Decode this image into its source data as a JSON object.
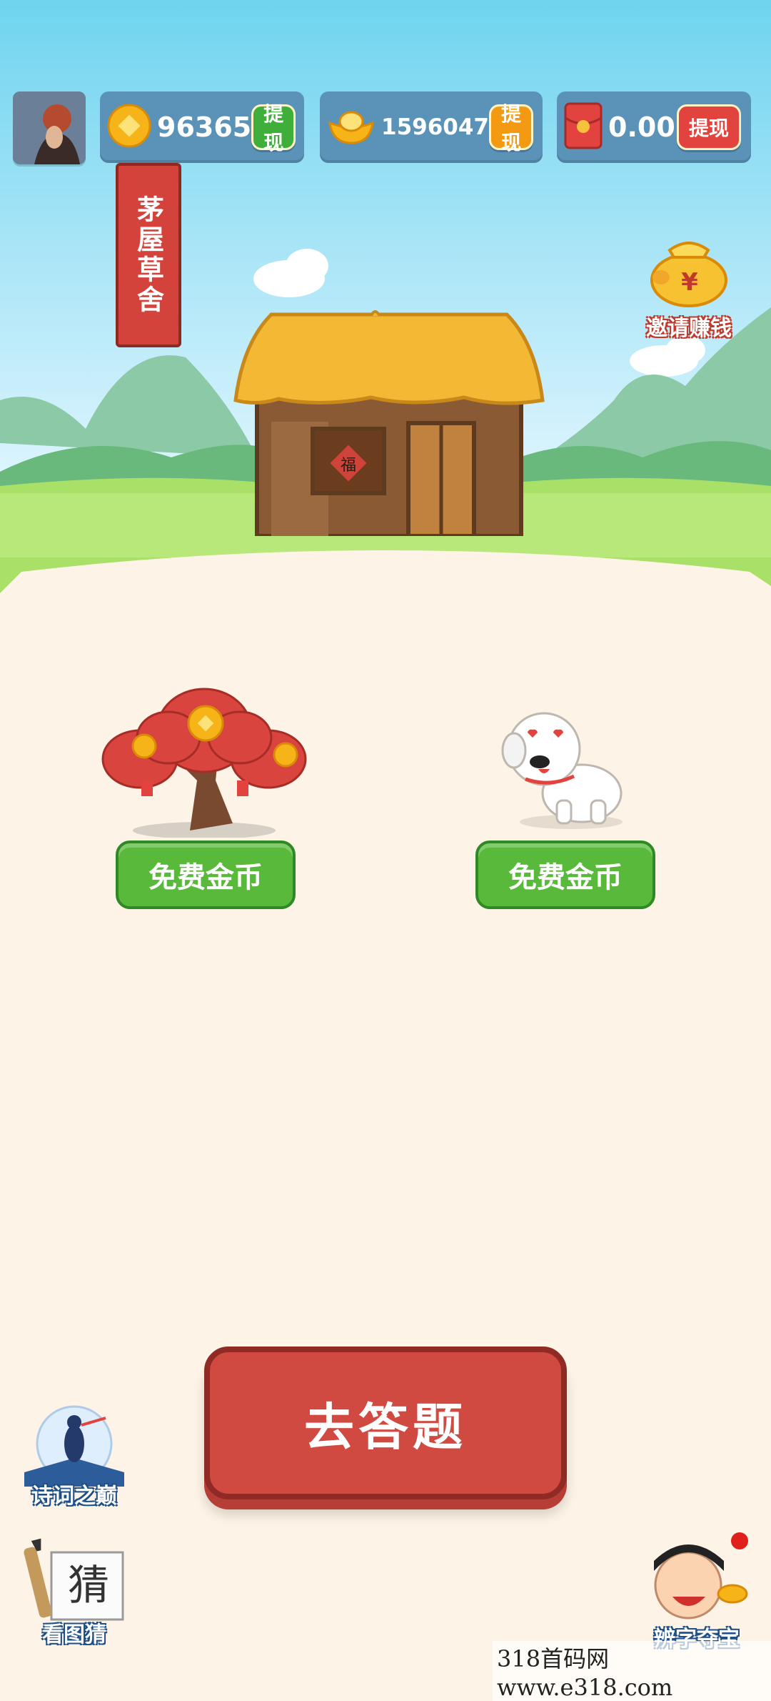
{
  "header": {
    "coins": {
      "value": "96365",
      "withdraw_label": "提现",
      "icon": "coin-icon"
    },
    "ingots": {
      "value": "1596047",
      "withdraw_label": "提现",
      "icon": "gold-ingot-icon"
    },
    "red_packet": {
      "value": "0.00",
      "withdraw_label": "提现",
      "icon": "red-envelope-icon"
    }
  },
  "location_banner": "茅屋草舍",
  "invite": {
    "label": "邀请赚钱",
    "icon": "piggy-bank-icon"
  },
  "house": {
    "door_sign": "福"
  },
  "money_tree": {
    "button_label": "免费金币"
  },
  "dog": {
    "button_label": "免费金币"
  },
  "main_action": {
    "label": "去答题"
  },
  "side_games": [
    {
      "label": "诗词之巅",
      "icon": "poetry-peak-icon"
    },
    {
      "label": "看图猜",
      "icon": "guess-picture-icon",
      "badge": "猜"
    }
  ],
  "treasure": {
    "label": "辨字夺宝",
    "icon": "scholar-character-icon"
  },
  "watermark": "318首码网   www.e318.com",
  "colors": {
    "sky_top": "#6fd4ef",
    "sky_bottom": "#dff4ff",
    "grass": "#a9e067",
    "ground": "#fdf4e7",
    "primary_red": "#d04a42",
    "green": "#58b93b"
  }
}
